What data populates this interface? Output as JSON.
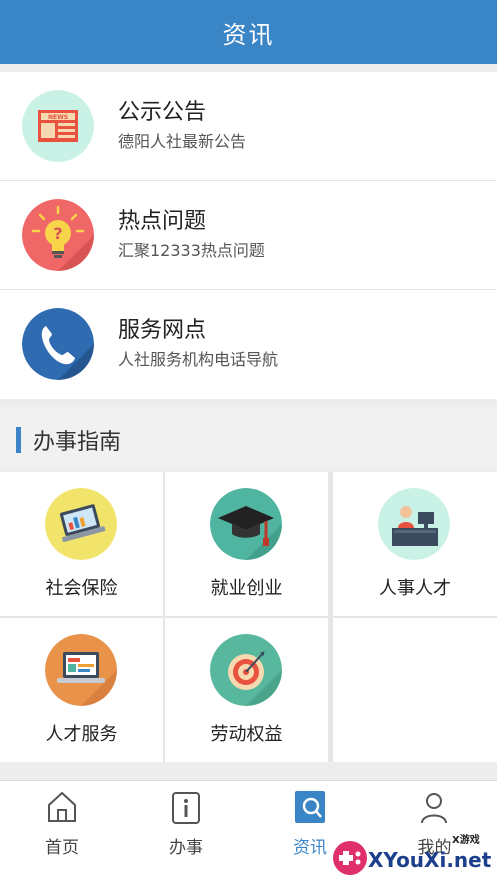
{
  "header": {
    "title": "资讯"
  },
  "news": [
    {
      "title": "公示公告",
      "subtitle": "德阳人社最新公告",
      "icon": "newspaper-icon",
      "icon_text": "NEWS"
    },
    {
      "title": "热点问题",
      "subtitle": "汇聚12333热点问题",
      "icon": "lightbulb-question-icon"
    },
    {
      "title": "服务网点",
      "subtitle": "人社服务机构电话导航",
      "icon": "phone-icon"
    }
  ],
  "guide": {
    "title": "办事指南",
    "items": [
      {
        "label": "社会保险",
        "icon": "laptop-chart-icon"
      },
      {
        "label": "就业创业",
        "icon": "graduation-cap-icon"
      },
      {
        "label": "人事人才",
        "icon": "office-worker-icon"
      },
      {
        "label": "人才服务",
        "icon": "laptop-dashboard-icon"
      },
      {
        "label": "劳动权益",
        "icon": "target-icon"
      }
    ]
  },
  "tabbar": {
    "active": "资讯",
    "tabs": [
      {
        "label": "首页",
        "icon": "home-icon"
      },
      {
        "label": "办事",
        "icon": "info-document-icon"
      },
      {
        "label": "资讯",
        "icon": "news-search-icon"
      },
      {
        "label": "我的",
        "icon": "user-icon"
      }
    ]
  },
  "watermark": {
    "text": "XYouXi.net",
    "top_text": "X游戏"
  },
  "colors": {
    "primary": "#3a85c6",
    "background": "#ededed"
  }
}
